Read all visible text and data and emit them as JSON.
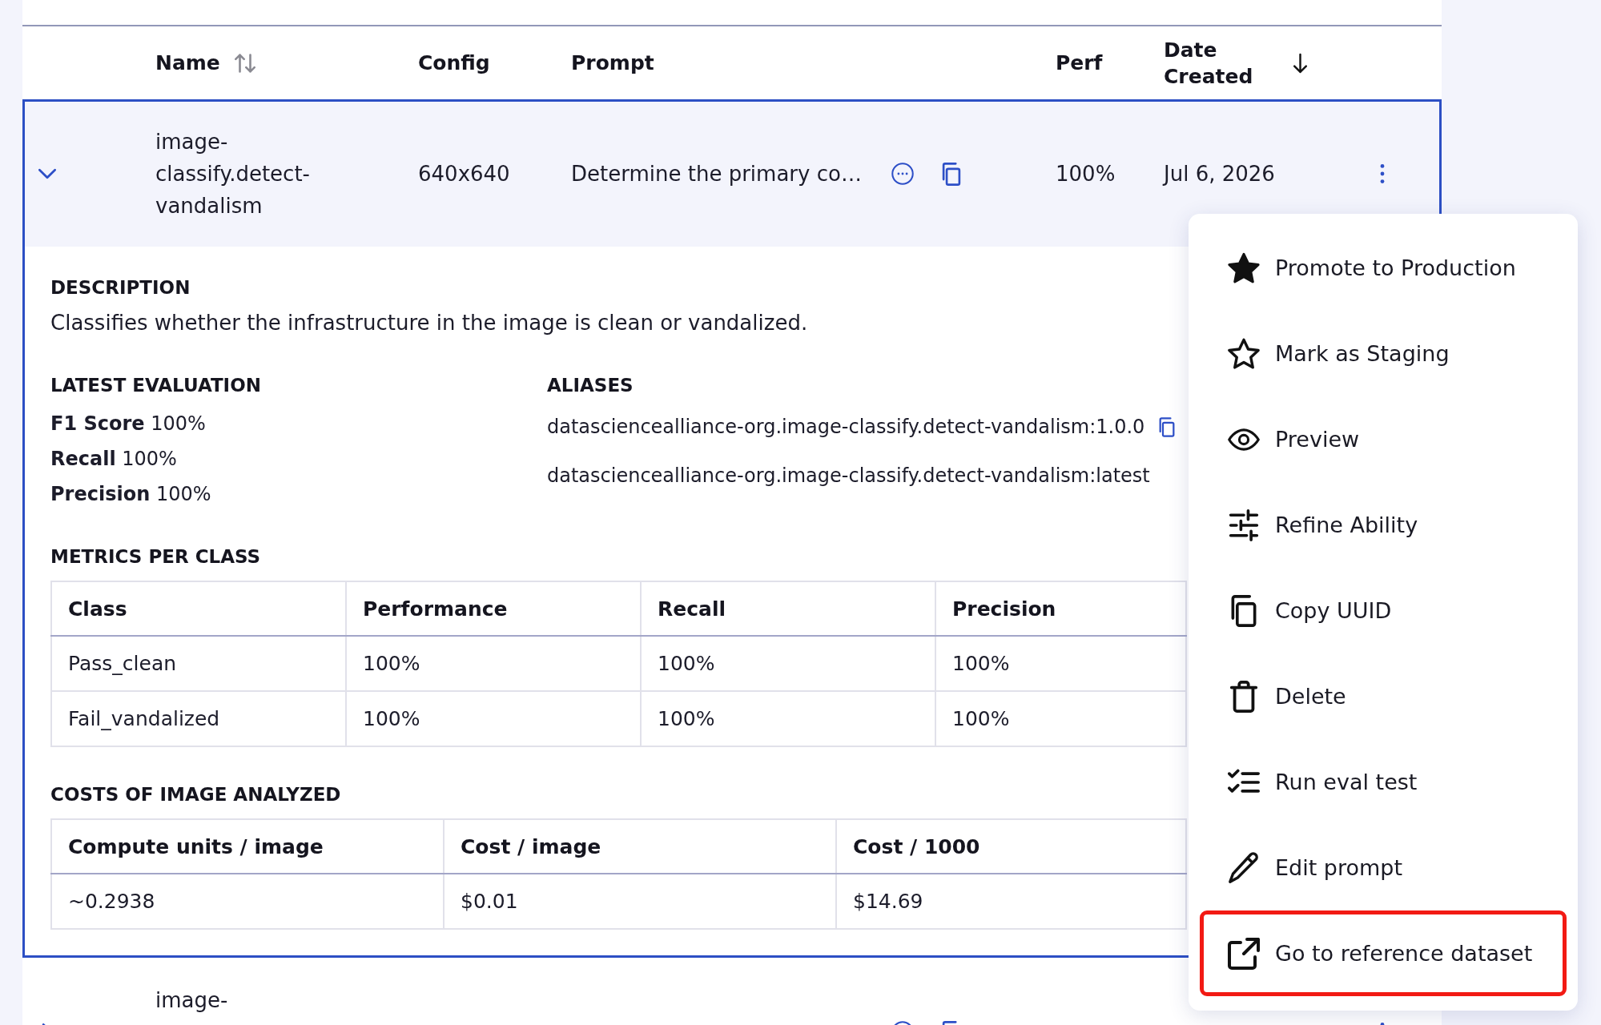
{
  "table": {
    "columns": [
      {
        "label": "Name",
        "sortable": true,
        "sorted": false
      },
      {
        "label": "Config",
        "sortable": false,
        "sorted": false
      },
      {
        "label": "Prompt",
        "sortable": false,
        "sorted": false
      },
      {
        "label": "Perf",
        "sortable": false,
        "sorted": false
      },
      {
        "label": "Date Created",
        "sortable": true,
        "sorted": true
      }
    ],
    "rows": [
      {
        "expanded": true,
        "name": "image-classify.detect-vandalism",
        "config": "640x640",
        "prompt": "Determine the primary co…",
        "perf": "100%",
        "date": "Jul 6, 2026",
        "details": {
          "description_title": "DESCRIPTION",
          "description": "Classifies whether the infrastructure in the image is clean or vandalized.",
          "evaluation_title": "LATEST EVALUATION",
          "evaluation": [
            "**F1 Score** 100%",
            "**Recall** 100%",
            "**Precision** 100%"
          ],
          "aliases_title": "ALIASES",
          "aliases": [
            {
              "text": "datasciencealliance-org.image-classify.detect-vandalism:1.0.0",
              "copy_icon": true
            },
            {
              "text": "datasciencealliance-org.image-classify.detect-vandalism:latest",
              "copy_icon": false
            }
          ],
          "metrics": {
            "title": "METRICS PER CLASS",
            "columns": [
              "Class",
              "Performance",
              "Recall",
              "Precision"
            ],
            "rows": [
              [
                "Pass_clean",
                "100%",
                "100%",
                "100%"
              ],
              [
                "Fail_vandalized",
                "100%",
                "100%",
                "100%"
              ]
            ]
          },
          "costs": {
            "title": "COSTS OF IMAGE ANALYZED",
            "columns": [
              "Compute units / image",
              "Cost / image",
              "Cost / 1000"
            ],
            "rows": [
              [
                "~0.2938",
                "$0.01",
                "$14.69"
              ]
            ]
          }
        }
      },
      {
        "expanded": false,
        "name": "image-"
      }
    ]
  },
  "menu": {
    "items": [
      {
        "label": "Promote to Production",
        "highlighted": false
      },
      {
        "label": "Mark as Staging",
        "highlighted": false
      },
      {
        "label": "Preview",
        "highlighted": false
      },
      {
        "label": "Refine Ability",
        "highlighted": false
      },
      {
        "label": "Copy UUID",
        "highlighted": false
      },
      {
        "label": "Delete",
        "highlighted": false
      },
      {
        "label": "Run eval test",
        "highlighted": false
      },
      {
        "label": "Edit prompt",
        "highlighted": false
      },
      {
        "label": "Go to reference dataset",
        "highlighted": true
      }
    ]
  }
}
